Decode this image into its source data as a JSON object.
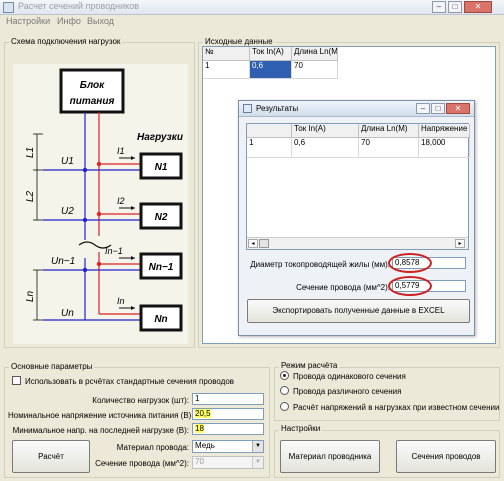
{
  "window": {
    "title": "Расчет сечений проводников"
  },
  "menu": [
    "Настройки",
    "Инфо",
    "Выход"
  ],
  "scheme": {
    "group_label": "Схема подключения нагрузок",
    "power_unit_line1": "Блок",
    "power_unit_line2": "питания",
    "loads_label": "Нагрузки",
    "loads": [
      "N1",
      "N2",
      "Nn−1",
      "Nn"
    ],
    "lengths": [
      "L1",
      "L2",
      "Ln"
    ],
    "voltages": [
      "U1",
      "U2",
      "Un−1",
      "Un"
    ],
    "currents": [
      "I1",
      "I2",
      "In−1",
      "In"
    ]
  },
  "source": {
    "group_label": "Исходные данные",
    "columns": [
      "№",
      "Ток In(A)",
      "Длина Ln(M"
    ],
    "rows": [
      [
        "1",
        "0,6",
        "70"
      ]
    ]
  },
  "results": {
    "title": "Результаты",
    "columns": [
      "Ток In(A)",
      "Длина Ln(M)",
      "Напряжение в т"
    ],
    "rows": [
      [
        "1",
        "0,6",
        "70",
        "18,000"
      ]
    ],
    "diameter_label": "Диаметр токопроводящей жилы (мм):",
    "diameter_value": "0,8578",
    "section_label": "Сечение провода (мм^2):",
    "section_value": "0,5779",
    "export_button": "Экспортировать полученные данные в EXCEL"
  },
  "params": {
    "group_label": "Основные параметры",
    "use_standard_label": "Использовать в рсчётах стандартные сечения проводов",
    "use_standard_checked": false,
    "load_count_label": "Количество нагрузок (шт):",
    "load_count": "1",
    "supply_voltage_label": "Номинальное напряжение источника питания (В):",
    "supply_voltage": "20,5",
    "min_voltage_label": "Минимальное напр. на последней нагрузке (В):",
    "min_voltage": "18",
    "material_label": "Материал провода:",
    "material": "Медь",
    "section_label": "Сечение провода (мм^2):",
    "section": "70",
    "calc_button": "Расчёт"
  },
  "mode": {
    "group_label": "Режим расчёта",
    "options": [
      "Провода одинакового сечения",
      "Провода различного сечения",
      "Расчёт напряжений в нагрузках при известном сечении"
    ],
    "selected": 0
  },
  "settings": {
    "group_label": "Настройки",
    "material_button": "Материал проводника",
    "sections_button": "Сечения проводов"
  },
  "colors": {
    "highlight": "#ffff66",
    "annotation": "#cc2222",
    "selection": "#2f5fb0"
  }
}
